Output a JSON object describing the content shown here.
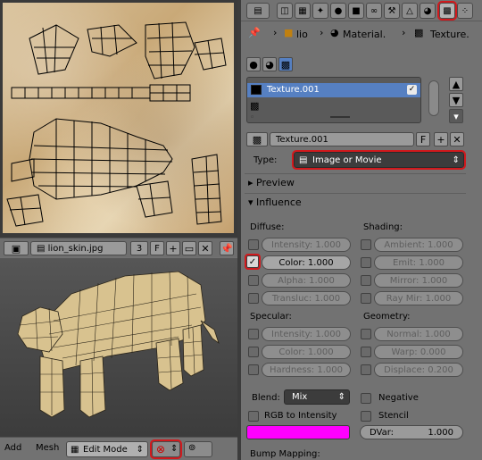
{
  "uv_editor": {
    "image_name": "lion_skin.jpg",
    "users": "3",
    "fake_user": "F"
  },
  "view3d_header": {
    "menu_add": "Add",
    "menu_mesh": "Mesh",
    "mode": "Edit Mode"
  },
  "breadcrumb": {
    "object": "lio",
    "material": "Material.",
    "texture": "Texture."
  },
  "texture_slots": {
    "selected_name": "Texture.001"
  },
  "texture_block": {
    "name": "Texture.001",
    "fake_user": "F"
  },
  "type": {
    "label": "Type:",
    "value": "Image or Movie"
  },
  "panels": {
    "preview": "Preview",
    "influence": "Influence",
    "bump_mapping": "Bump Mapping:"
  },
  "diffuse": {
    "heading": "Diffuse:",
    "items": [
      {
        "label": "Intensity:",
        "value": "1.000",
        "enabled": false
      },
      {
        "label": "Color:",
        "value": "1.000",
        "enabled": true
      },
      {
        "label": "Alpha:",
        "value": "1.000",
        "enabled": false
      },
      {
        "label": "Transluc:",
        "value": "1.000",
        "enabled": false
      }
    ]
  },
  "shading": {
    "heading": "Shading:",
    "items": [
      {
        "label": "Ambient:",
        "value": "1.000"
      },
      {
        "label": "Emit:",
        "value": "1.000"
      },
      {
        "label": "Mirror:",
        "value": "1.000"
      },
      {
        "label": "Ray Mir:",
        "value": "1.000"
      }
    ]
  },
  "specular": {
    "heading": "Specular:",
    "items": [
      {
        "label": "Intensity:",
        "value": "1.000"
      },
      {
        "label": "Color:",
        "value": "1.000"
      },
      {
        "label": "Hardness:",
        "value": "1.000"
      }
    ]
  },
  "geometry": {
    "heading": "Geometry:",
    "items": [
      {
        "label": "Normal:",
        "value": "1.000"
      },
      {
        "label": "Warp:",
        "value": "0.000"
      },
      {
        "label": "Displace:",
        "value": "0.200"
      }
    ]
  },
  "blend": {
    "label": "Blend:",
    "value": "Mix",
    "negative": "Negative",
    "rgb_to_intensity": "RGB to Intensity",
    "stencil": "Stencil",
    "dvar_label": "DVar:",
    "dvar_value": "1.000",
    "color": "#ff00ff"
  },
  "colors": {
    "highlight": "#d1191d",
    "selection": "#5680c2"
  }
}
